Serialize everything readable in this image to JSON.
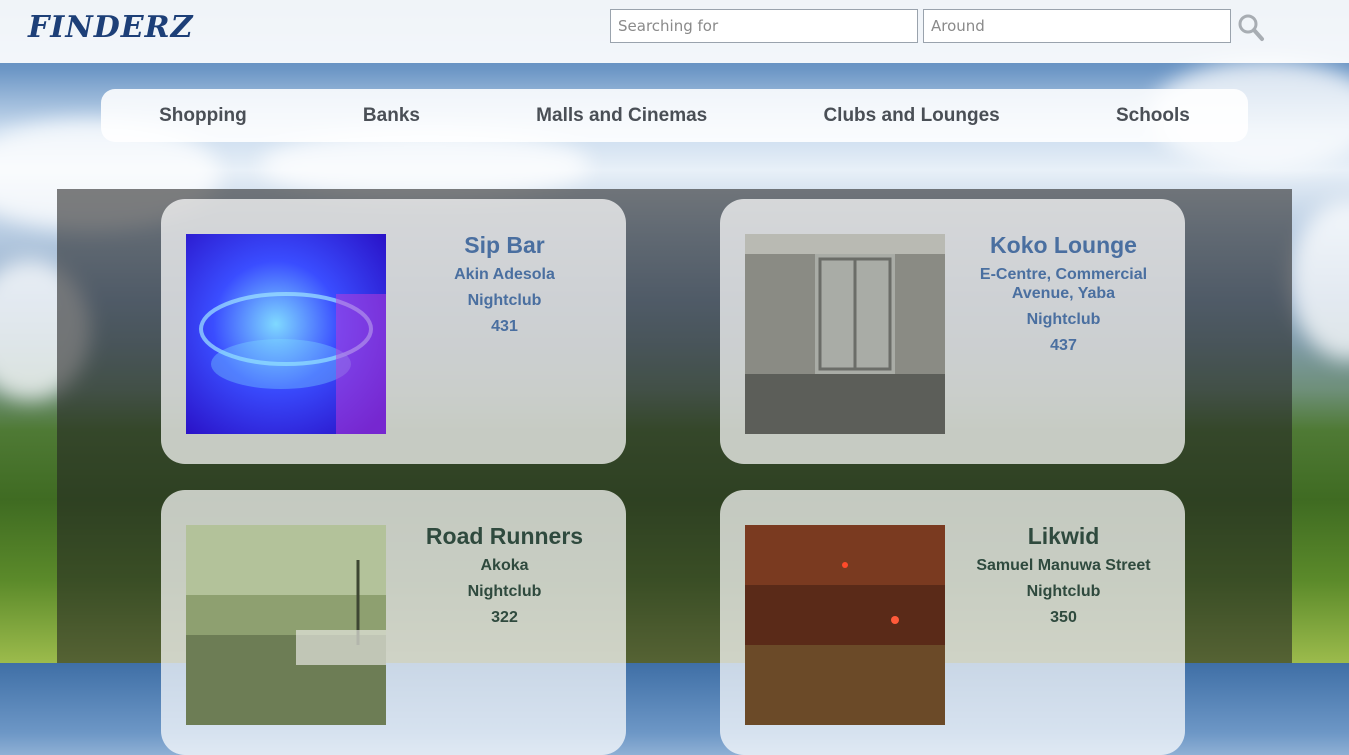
{
  "brand": {
    "logo": "FINDERZ"
  },
  "search": {
    "what_placeholder": "Searching for",
    "where_placeholder": "Around",
    "button_icon": "search-icon"
  },
  "nav": {
    "items": [
      {
        "label": "Shopping"
      },
      {
        "label": "Banks"
      },
      {
        "label": "Malls and Cinemas"
      },
      {
        "label": "Clubs and Lounges"
      },
      {
        "label": "Schools"
      }
    ]
  },
  "listings": [
    {
      "name": "Sip Bar",
      "address": "Akin Adesola",
      "category": "Nightclub",
      "count": "431"
    },
    {
      "name": "Koko Lounge",
      "address": "E-Centre, Commercial Avenue, Yaba",
      "category": "Nightclub",
      "count": "437"
    },
    {
      "name": "Road Runners",
      "address": "Akoka",
      "category": "Nightclub",
      "count": "322"
    },
    {
      "name": "Likwid",
      "address": "Samuel Manuwa Street",
      "category": "Nightclub",
      "count": "350"
    }
  ],
  "colors": {
    "brand": "#1d3f78",
    "listing_title": "#4a6fa0",
    "nav_text": "#4a4f56"
  }
}
